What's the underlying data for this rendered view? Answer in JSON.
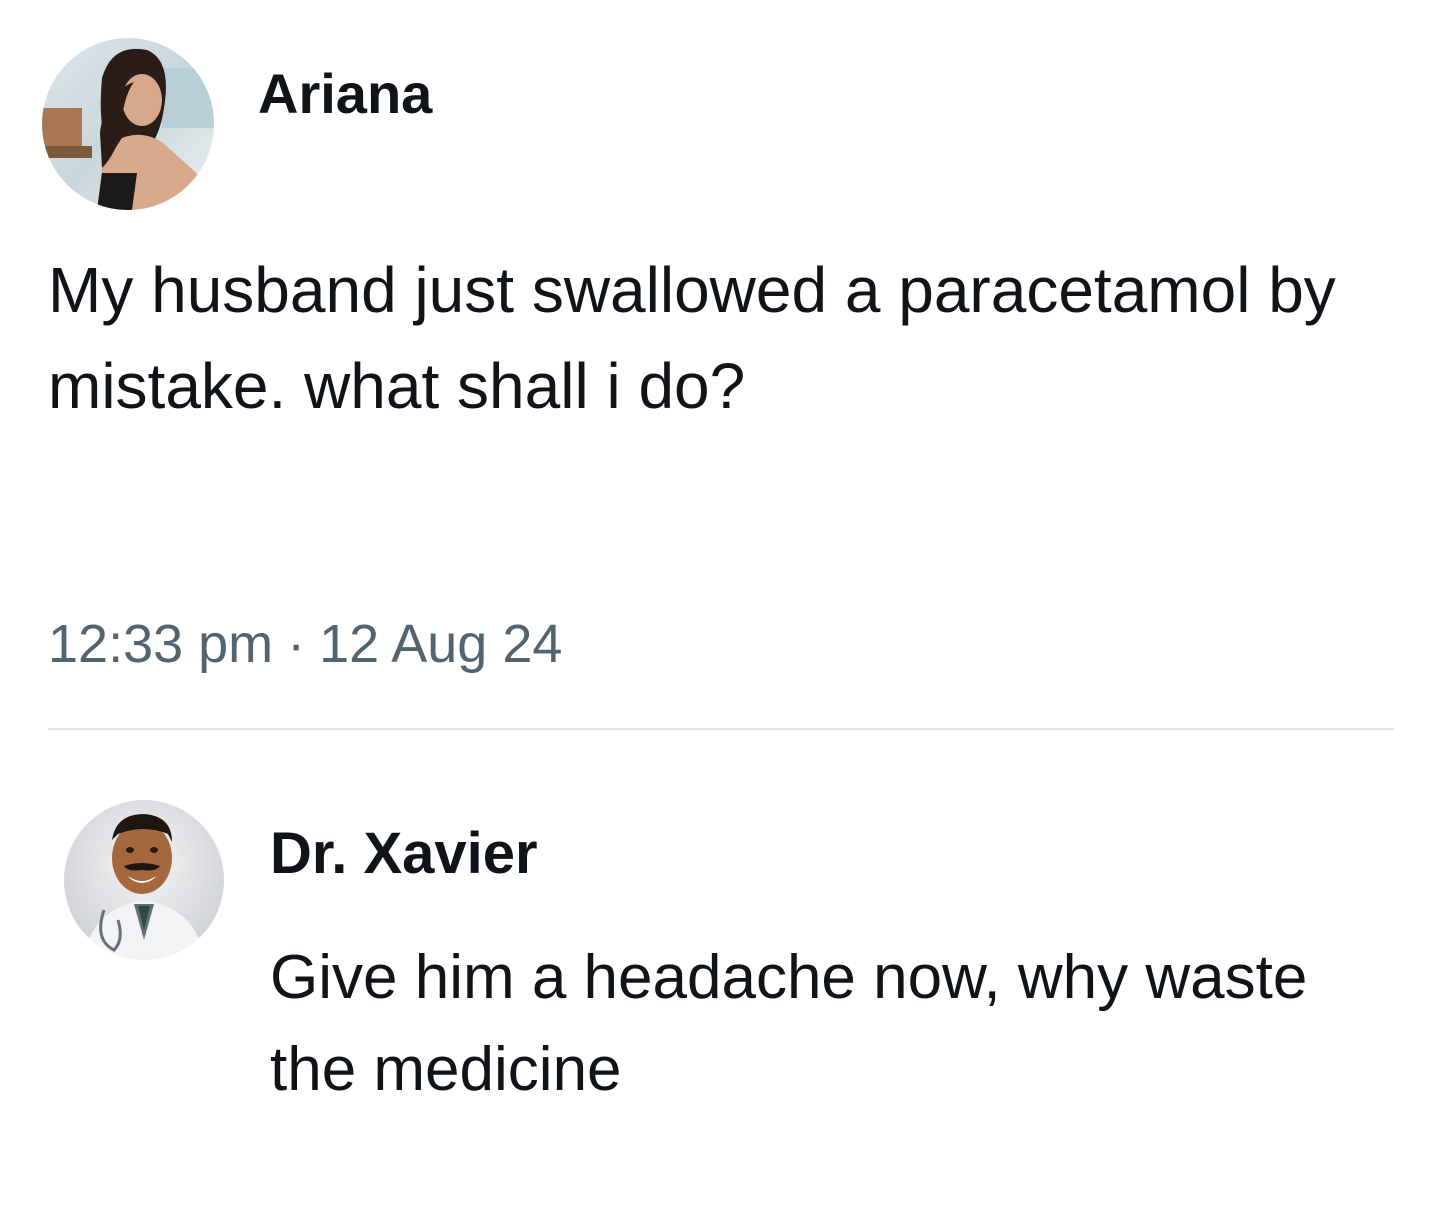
{
  "post": {
    "author": {
      "name": "Ariana",
      "avatar_icon": "woman-portrait-avatar"
    },
    "text": "My husband just swallowed a paracetamol by mistake. what shall i do?",
    "time": "12:33 pm",
    "separator": "·",
    "date": "12 Aug 24"
  },
  "reply": {
    "author": {
      "name": "Dr. Xavier",
      "avatar_icon": "doctor-portrait-avatar"
    },
    "text": "Give him a headache now, why waste the medicine"
  },
  "colors": {
    "text_primary": "#0f1419",
    "text_secondary": "#536471",
    "divider": "#e3e6e8",
    "background": "#ffffff"
  }
}
